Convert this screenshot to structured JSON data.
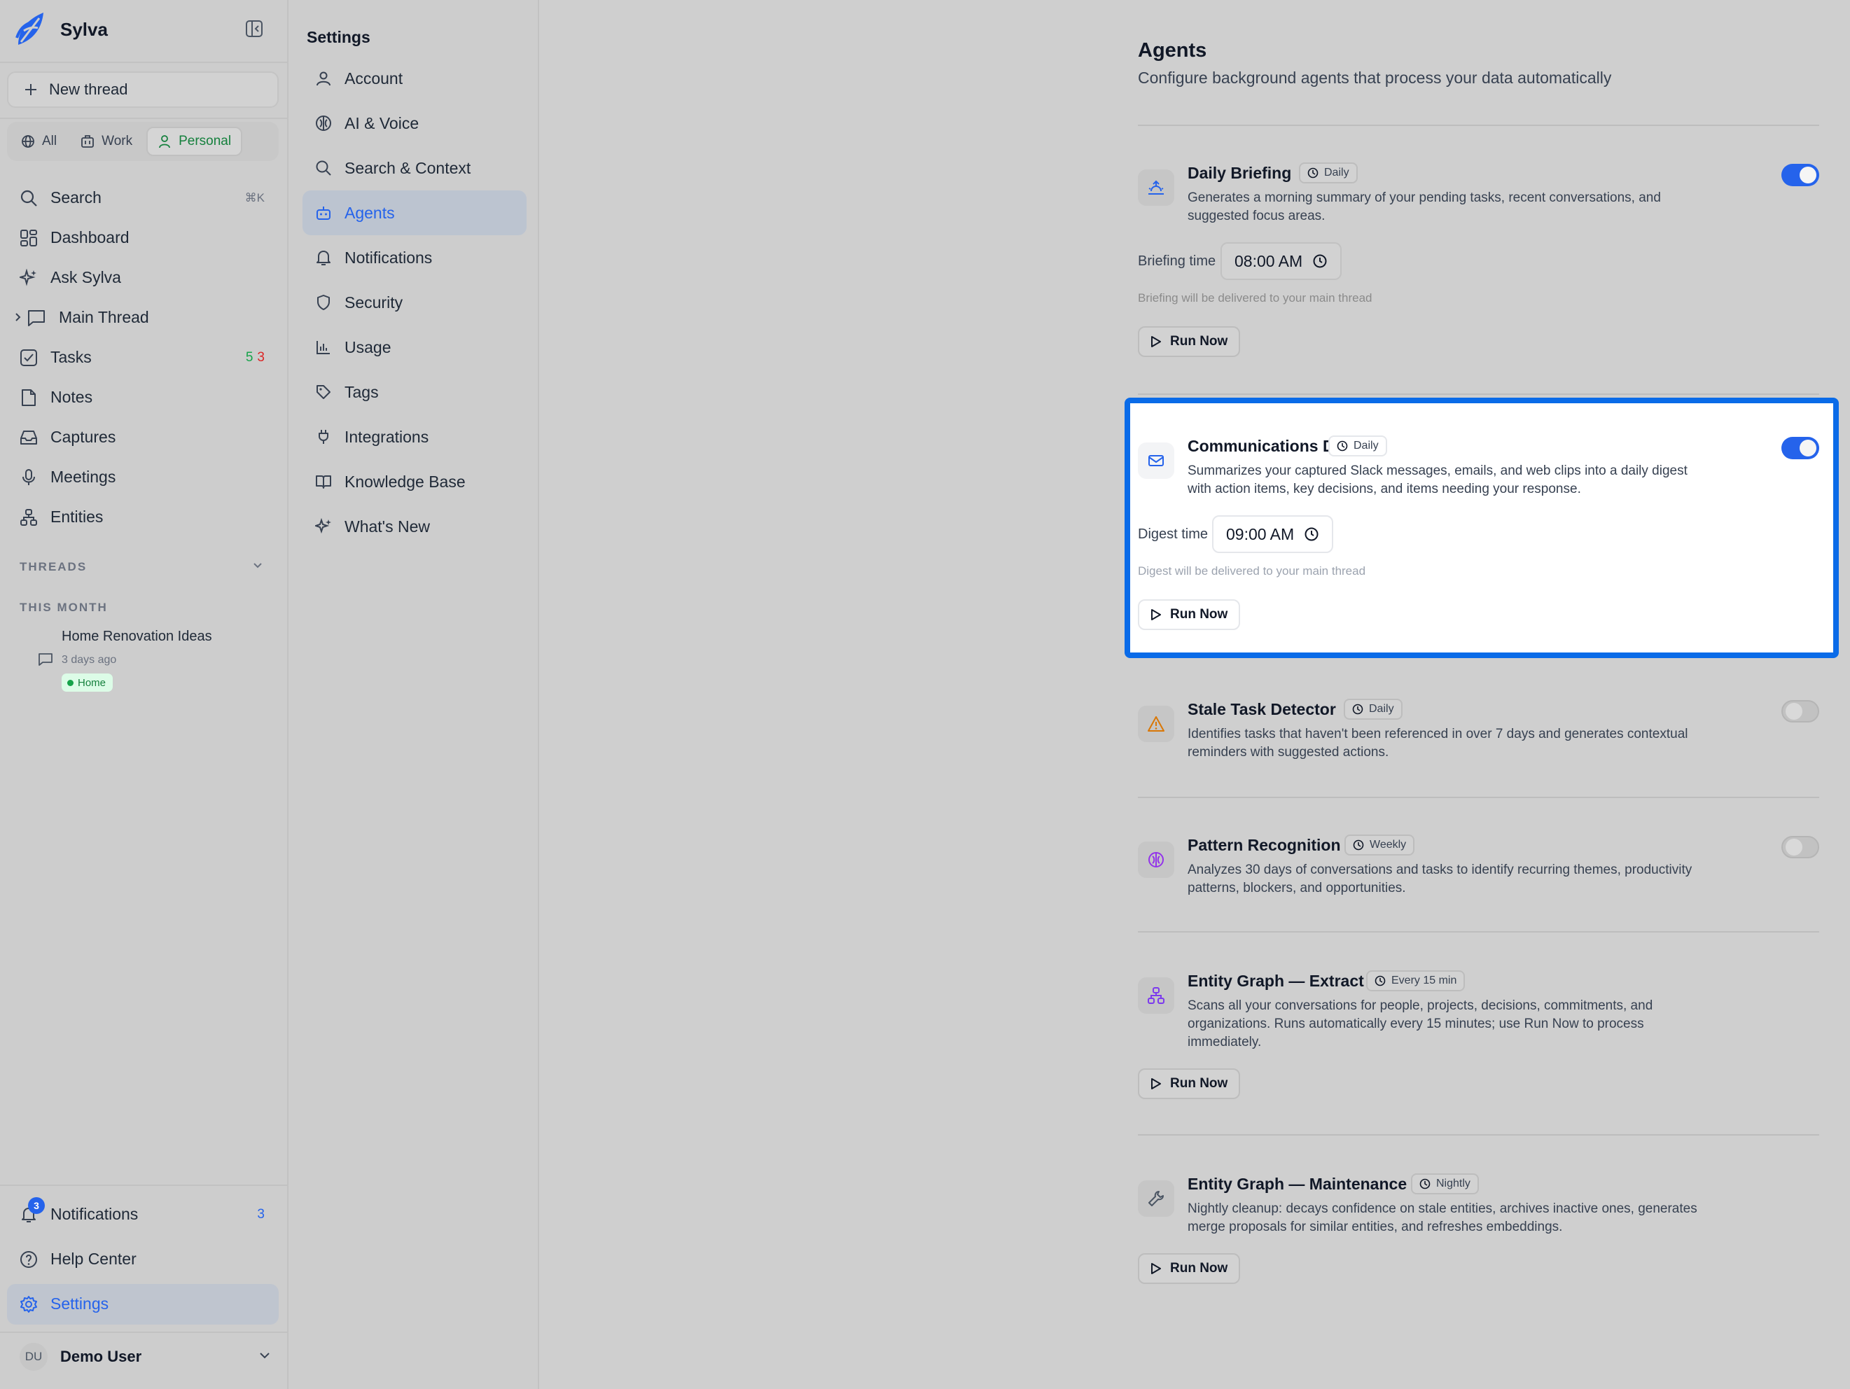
{
  "brand": {
    "name": "Sylva"
  },
  "sidebar": {
    "new_thread": "New thread",
    "scopes": [
      "All",
      "Work",
      "Personal"
    ],
    "items": [
      {
        "label": "Search",
        "kbd": "⌘K"
      },
      {
        "label": "Dashboard"
      },
      {
        "label": "Ask Sylva"
      },
      {
        "label": "Main Thread"
      },
      {
        "label": "Tasks",
        "count_green": "5",
        "count_red": "3"
      },
      {
        "label": "Notes"
      },
      {
        "label": "Captures"
      },
      {
        "label": "Meetings"
      },
      {
        "label": "Entities"
      }
    ],
    "threads_header": "THREADS",
    "this_month": "THIS MONTH",
    "thread": {
      "title": "Home Renovation Ideas",
      "time": "3 days ago",
      "tag": "Home"
    },
    "bottom": [
      {
        "label": "Notifications",
        "count": "3",
        "badge": "3"
      },
      {
        "label": "Help Center"
      },
      {
        "label": "Settings"
      }
    ],
    "user": {
      "initials": "DU",
      "name": "Demo User"
    }
  },
  "settings_nav": {
    "title": "Settings",
    "items": [
      "Account",
      "AI & Voice",
      "Search & Context",
      "Agents",
      "Notifications",
      "Security",
      "Usage",
      "Tags",
      "Integrations",
      "Knowledge Base",
      "What's New"
    ],
    "active": "Agents"
  },
  "main": {
    "title": "Agents",
    "subtitle": "Configure background agents that process your data automatically",
    "agents": [
      {
        "name": "Daily Briefing",
        "freq": "Daily",
        "enabled": true,
        "desc": "Generates a morning summary of your pending tasks, recent conversations, and suggested focus areas.",
        "time_label": "Briefing time",
        "time": "08:00 AM",
        "hint": "Briefing will be delivered to your main thread",
        "run": "Run Now"
      },
      {
        "name": "Communications Digest",
        "freq": "Daily",
        "enabled": true,
        "desc": "Summarizes your captured Slack messages, emails, and web clips into a daily digest with action items, key decisions, and items needing your response.",
        "time_label": "Digest time",
        "time": "09:00 AM",
        "hint": "Digest will be delivered to your main thread",
        "run": "Run Now"
      },
      {
        "name": "Stale Task Detector",
        "freq": "Daily",
        "enabled": false,
        "desc": "Identifies tasks that haven't been referenced in over 7 days and generates contextual reminders with suggested actions."
      },
      {
        "name": "Pattern Recognition",
        "freq": "Weekly",
        "enabled": false,
        "desc": "Analyzes 30 days of conversations and tasks to identify recurring themes, productivity patterns, blockers, and opportunities."
      },
      {
        "name": "Entity Graph — Extract",
        "freq": "Every 15 min",
        "desc": "Scans all your conversations for people, projects, decisions, commitments, and organizations. Runs automatically every 15 minutes; use Run Now to process immediately.",
        "run": "Run Now"
      },
      {
        "name": "Entity Graph — Maintenance",
        "freq": "Nightly",
        "desc": "Nightly cleanup: decays confidence on stale entities, archives inactive ones, generates merge proposals for similar entities, and refreshes embeddings.",
        "run": "Run Now"
      }
    ]
  },
  "colors": {
    "accent": "#2563eb",
    "highlight": "#0a6be8",
    "green": "#16a34a",
    "red": "#dc2626"
  }
}
